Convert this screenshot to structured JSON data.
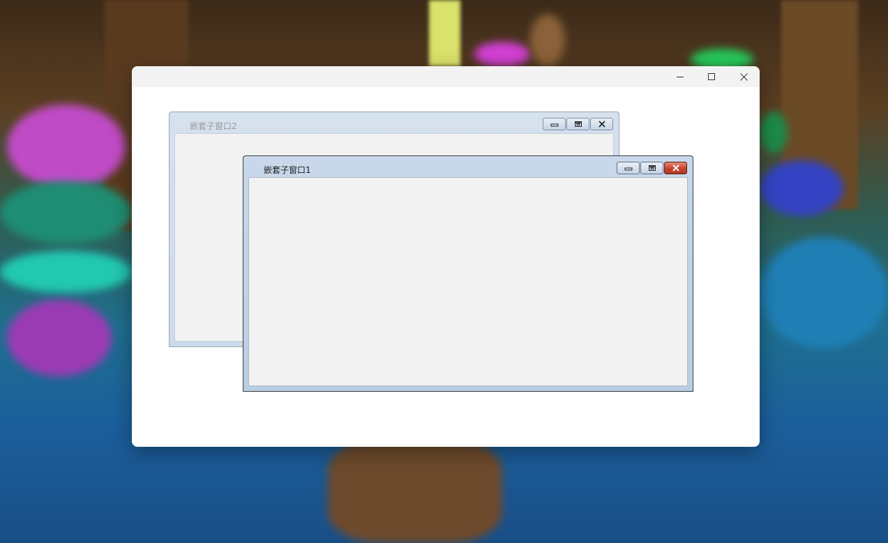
{
  "main_window": {
    "title": "",
    "controls": {
      "minimize_icon": "minimize-icon",
      "maximize_icon": "maximize-icon",
      "close_icon": "close-icon"
    }
  },
  "mdi_children": [
    {
      "title": "嵌套子窗口2",
      "state": "inactive",
      "buttons": [
        "minimize",
        "restore",
        "close"
      ]
    },
    {
      "title": "嵌套子窗口1",
      "state": "active",
      "buttons": [
        "minimize",
        "restore",
        "close"
      ]
    }
  ],
  "colors": {
    "main_window_bg": "#ffffff",
    "main_titlebar_bg": "#f3f3f3",
    "child_frame": "#c9d8ea",
    "child_client_bg": "#f2f2f2",
    "active_close_button": "#c7432c"
  }
}
